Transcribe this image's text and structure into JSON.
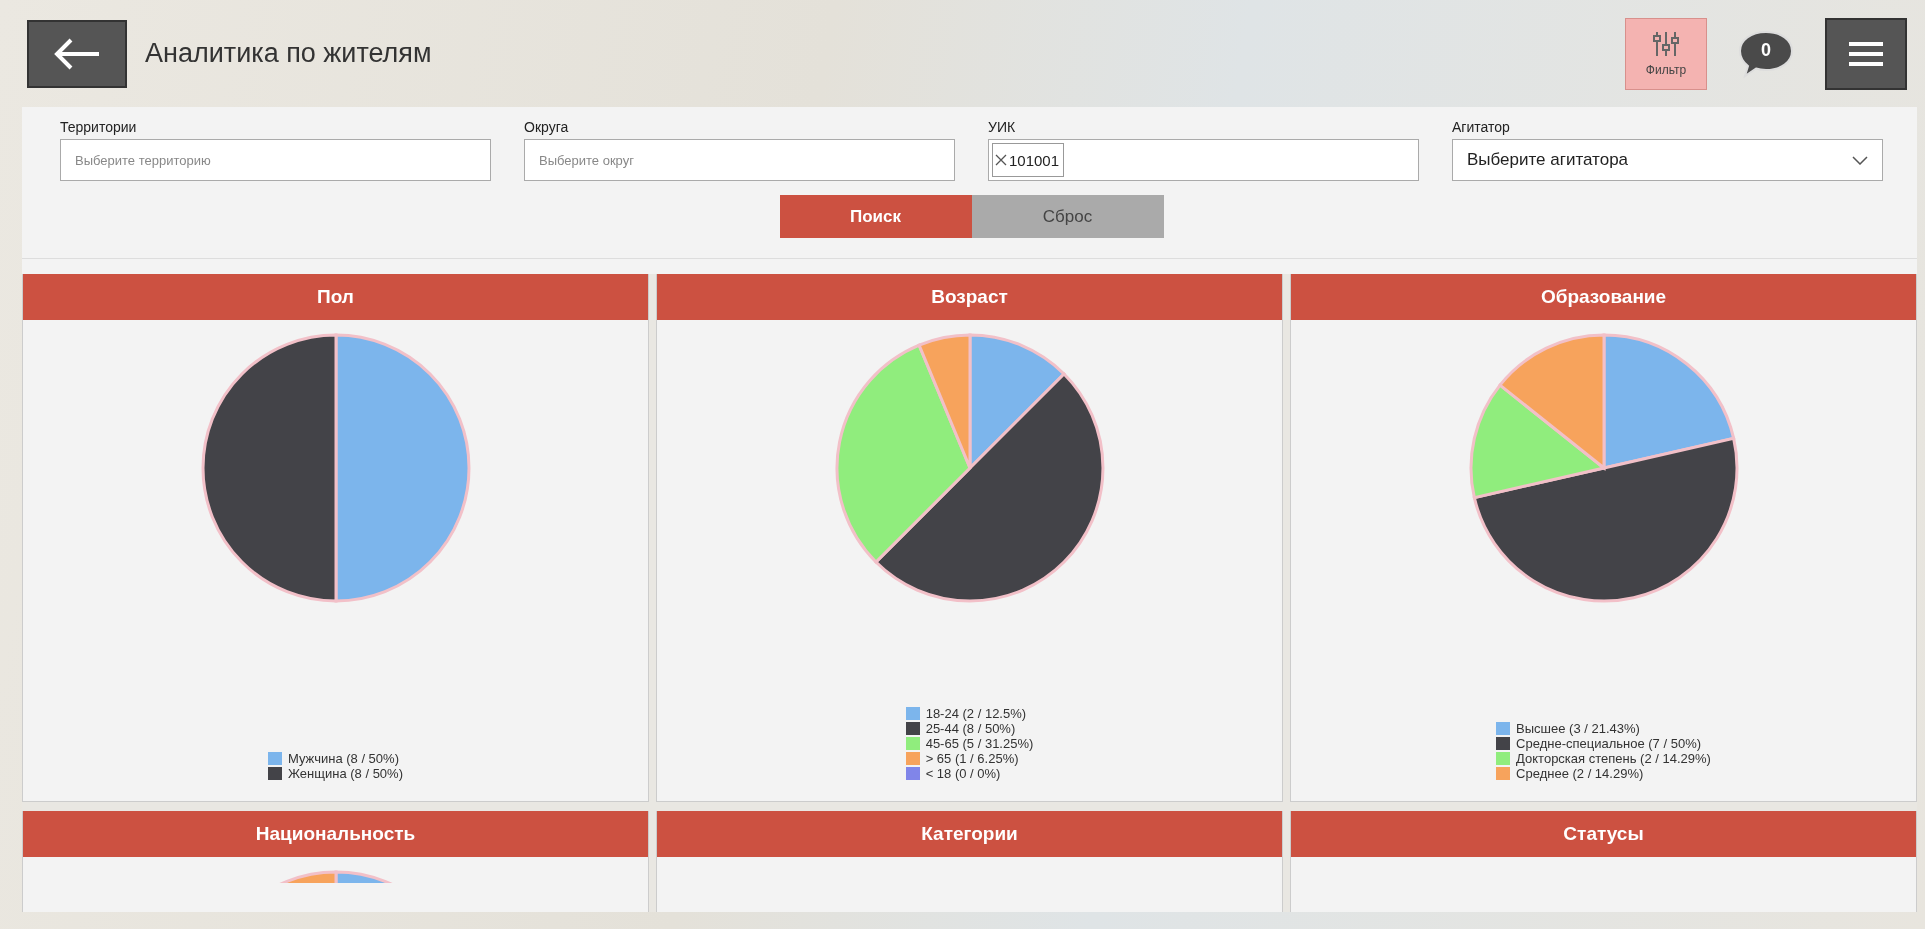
{
  "header": {
    "title": "Аналитика по жителям",
    "filter_button": "Фильтр",
    "messages_count": "0"
  },
  "filters": [
    {
      "kind": "text",
      "label": "Территории",
      "placeholder": "Выберите территорию"
    },
    {
      "kind": "text",
      "label": "Округа",
      "placeholder": "Выберите округ"
    },
    {
      "kind": "tags",
      "label": "УИК",
      "tags": [
        "101001"
      ]
    },
    {
      "kind": "select",
      "label": "Агитатор",
      "value": "Выберите агитатора"
    }
  ],
  "buttons": [
    {
      "kind": "primary",
      "label": "Поиск"
    },
    {
      "kind": "secondary",
      "label": "Сброс"
    }
  ],
  "charts": [
    {
      "kind": "pie",
      "title": "Пол",
      "chart_data": {
        "type": "pie",
        "categories": [
          "Мужчина",
          "Женщина"
        ],
        "values": [
          50,
          50
        ]
      },
      "legend": [
        {
          "detail": "(8 / 50%)",
          "color": "#7cb5ec"
        },
        {
          "detail": "(8 / 50%)",
          "color": "#434348"
        }
      ]
    },
    {
      "kind": "pie",
      "title": "Возраст",
      "chart_data": {
        "type": "pie",
        "categories": [
          "18-24",
          "25-44",
          "45-65",
          "> 65",
          "< 18"
        ],
        "values": [
          12.5,
          50,
          31.25,
          6.25,
          0
        ]
      },
      "legend": [
        {
          "detail": "(2 / 12.5%)",
          "color": "#7cb5ec"
        },
        {
          "detail": "(8 / 50%)",
          "color": "#434348"
        },
        {
          "detail": "(5 / 31.25%)",
          "color": "#90ed7d"
        },
        {
          "detail": "(1 / 6.25%)",
          "color": "#f7a35c"
        },
        {
          "detail": "(0 / 0%)",
          "color": "#8085e9"
        }
      ]
    },
    {
      "kind": "pie",
      "title": "Образование",
      "chart_data": {
        "type": "pie",
        "categories": [
          "Высшее",
          "Средне-специальное",
          "Докторская степень",
          "Среднее"
        ],
        "values": [
          21.43,
          50,
          14.29,
          14.29
        ]
      },
      "legend": [
        {
          "detail": "(3 / 21.43%)",
          "color": "#7cb5ec"
        },
        {
          "detail": "(7 / 50%)",
          "color": "#434348"
        },
        {
          "detail": "(2 / 14.29%)",
          "color": "#90ed7d"
        },
        {
          "detail": "(2 / 14.29%)",
          "color": "#f7a35c"
        }
      ]
    },
    {
      "kind": "stub",
      "title": "Национальность"
    },
    {
      "kind": "empty",
      "title": "Категории"
    },
    {
      "kind": "empty",
      "title": "Статусы"
    }
  ]
}
